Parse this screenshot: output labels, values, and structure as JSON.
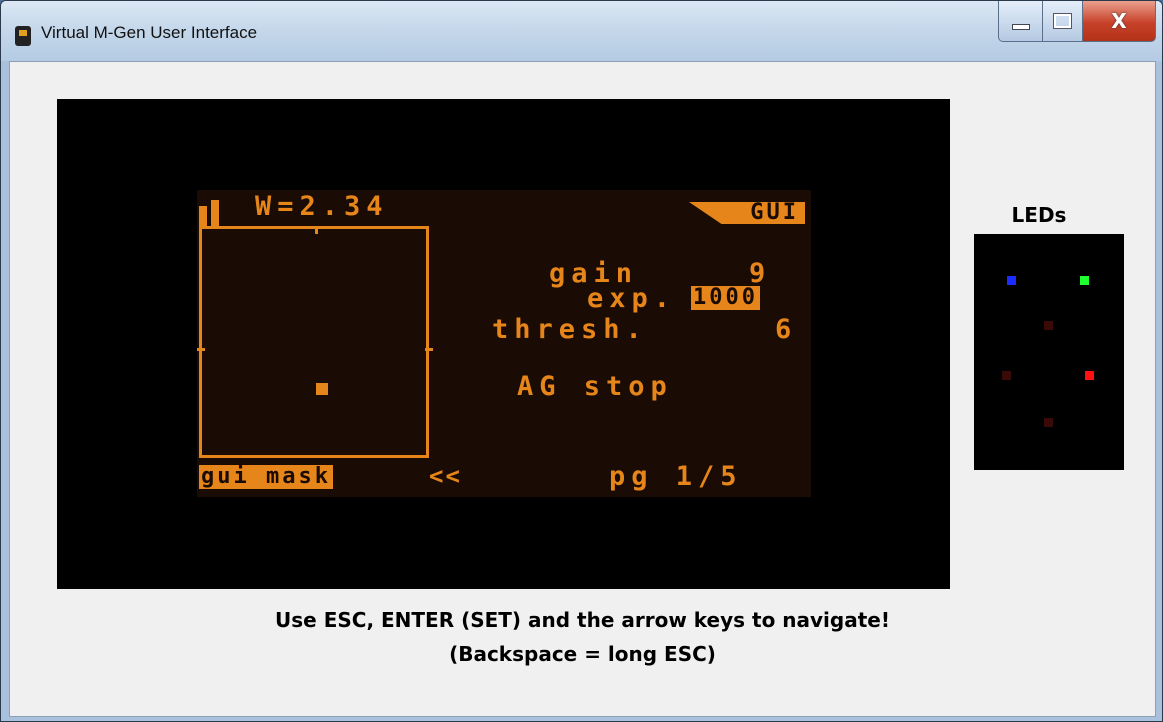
{
  "window": {
    "title": "Virtual M-Gen User Interface",
    "close_glyph": "X"
  },
  "lcd": {
    "width_readout": "W=2.34",
    "tab_label": "GUI",
    "gain_label": "gain",
    "gain_value": "9",
    "exp_label": "exp.",
    "exp_value": "1000",
    "thresh_label": "thresh.",
    "thresh_value": "6",
    "status": "AG stop",
    "mode_label": "gui mask",
    "nav_arrows": "<<",
    "page_indicator": "pg 1/5",
    "color": "#e6861a",
    "background": "#1a0b04"
  },
  "instructions": {
    "line1": "Use ESC, ENTER (SET) and the arrow keys to navigate!",
    "line2": "(Backspace = long ESC)"
  },
  "leds": {
    "label": "LEDs",
    "items": [
      {
        "name": "blue",
        "color": "#1a2cff"
      },
      {
        "name": "green",
        "color": "#20ff30"
      },
      {
        "name": "dim-red-1",
        "color": "#3a0a08"
      },
      {
        "name": "dim-red-2",
        "color": "#3a0a08"
      },
      {
        "name": "red",
        "color": "#ff1010"
      },
      {
        "name": "dim-red-3",
        "color": "#3a0a08"
      }
    ]
  }
}
